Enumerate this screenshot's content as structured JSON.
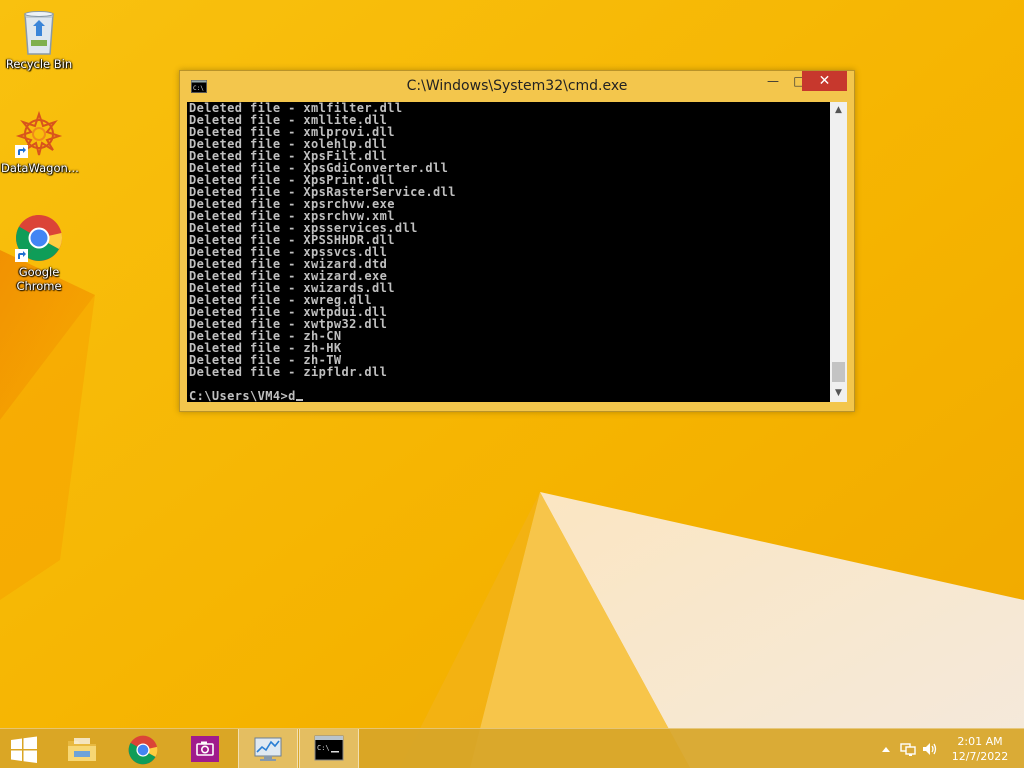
{
  "desktop_icons": [
    {
      "label": "Recycle Bin"
    },
    {
      "label": "DataWagon..."
    },
    {
      "label": "Google Chrome"
    }
  ],
  "cmd_window": {
    "title": "C:\\Windows\\System32\\cmd.exe",
    "lines": [
      "Deleted file - xmlfilter.dll",
      "Deleted file - xmllite.dll",
      "Deleted file - xmlprovi.dll",
      "Deleted file - xolehlp.dll",
      "Deleted file - XpsFilt.dll",
      "Deleted file - XpsGdiConverter.dll",
      "Deleted file - XpsPrint.dll",
      "Deleted file - XpsRasterService.dll",
      "Deleted file - xpsrchvw.exe",
      "Deleted file - xpsrchvw.xml",
      "Deleted file - xpsservices.dll",
      "Deleted file - XPSSHHDR.dll",
      "Deleted file - xpssvcs.dll",
      "Deleted file - xwizard.dtd",
      "Deleted file - xwizard.exe",
      "Deleted file - xwizards.dll",
      "Deleted file - xwreg.dll",
      "Deleted file - xwtpdui.dll",
      "Deleted file - xwtpw32.dll",
      "Deleted file - zh-CN",
      "Deleted file - zh-HK",
      "Deleted file - zh-TW",
      "Deleted file - zipfldr.dll",
      "",
      "C:\\Users\\VM4>d"
    ],
    "buttons": {
      "minimize": "—",
      "maximize": "□",
      "close": "✕"
    }
  },
  "taskbar": {
    "items": [
      {
        "name": "start",
        "icon": "windows-logo-icon"
      },
      {
        "name": "file-explorer",
        "icon": "folder-icon"
      },
      {
        "name": "chrome",
        "icon": "chrome-icon"
      },
      {
        "name": "camera",
        "icon": "camera-icon"
      },
      {
        "name": "task-manager",
        "icon": "monitor-chart-icon"
      },
      {
        "name": "cmd",
        "icon": "console-icon",
        "active": true
      }
    ],
    "clock": {
      "time": "2:01 AM",
      "date": "12/7/2022"
    }
  },
  "colors": {
    "wallpaper": "#f5b400",
    "window_frame": "#f3c64c",
    "close_button": "#c7382d",
    "console_bg": "#000000",
    "console_text": "#c0c0c0"
  }
}
